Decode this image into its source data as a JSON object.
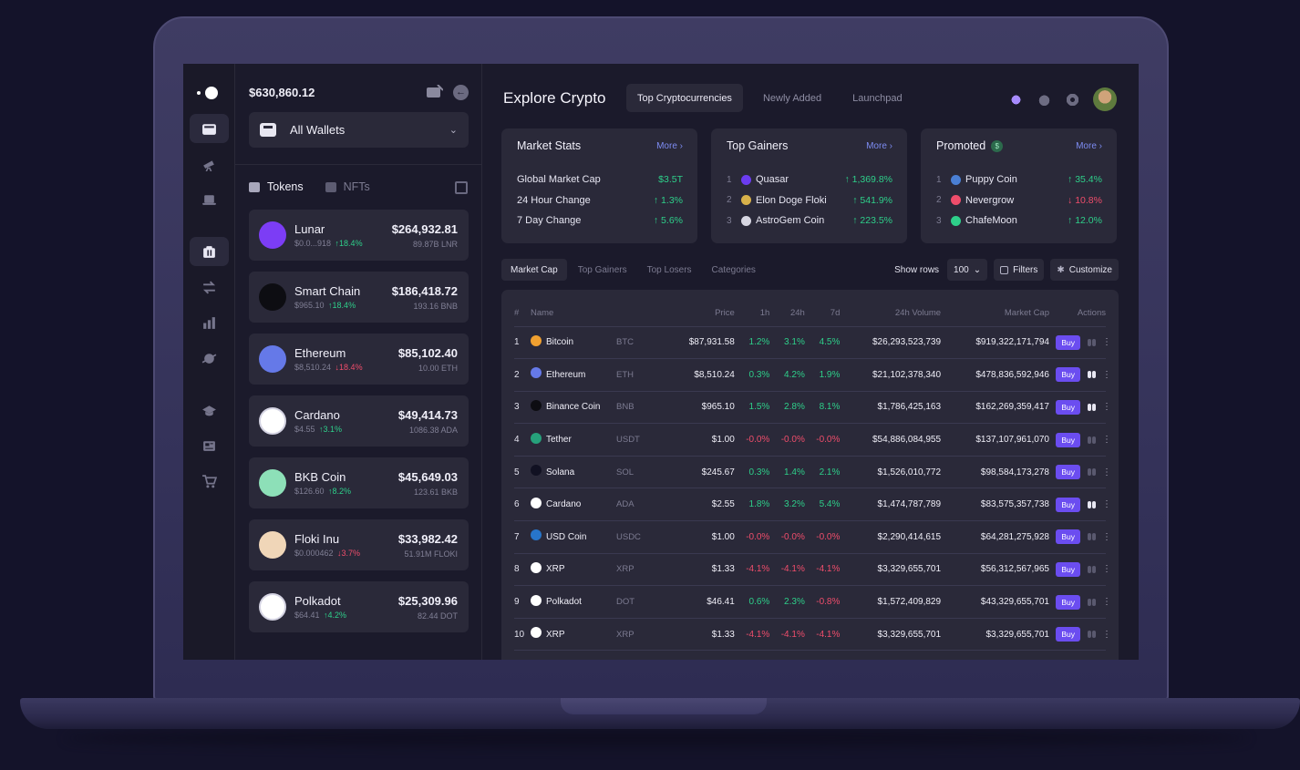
{
  "wallet": {
    "balance": "$630,860.12",
    "selector_label": "All Wallets",
    "tabs": {
      "tokens": "Tokens",
      "nfts": "NFTs"
    },
    "tokens": [
      {
        "name": "Lunar",
        "price": "$0.0...918",
        "change": "18.4%",
        "dir": "up",
        "value": "$264,932.81",
        "amount": "89.87B LNR",
        "color": "#7c3df5"
      },
      {
        "name": "Smart Chain",
        "price": "$965.10",
        "change": "18.4%",
        "dir": "up",
        "value": "$186,418.72",
        "amount": "193.16 BNB",
        "color": "#0d0d12"
      },
      {
        "name": "Ethereum",
        "price": "$8,510.24",
        "change": "18.4%",
        "dir": "down",
        "value": "$85,102.40",
        "amount": "10.00 ETH",
        "color": "#6579e8"
      },
      {
        "name": "Cardano",
        "price": "$4.55",
        "change": "3.1%",
        "dir": "up",
        "value": "$49,414.73",
        "amount": "1086.38 ADA",
        "color": "#ffffff"
      },
      {
        "name": "BKB Coin",
        "price": "$126.60",
        "change": "8.2%",
        "dir": "up",
        "value": "$45,649.03",
        "amount": "123.61 BKB",
        "color": "#8de0b8"
      },
      {
        "name": "Floki Inu",
        "price": "$0.000462",
        "change": "3.7%",
        "dir": "down",
        "value": "$33,982.42",
        "amount": "51.91M FLOKI",
        "color": "#f0d6b8"
      },
      {
        "name": "Polkadot",
        "price": "$64.41",
        "change": "4.2%",
        "dir": "up",
        "value": "$25,309.96",
        "amount": "82.44 DOT",
        "color": "#ffffff"
      }
    ]
  },
  "header": {
    "title": "Explore Crypto",
    "tabs": [
      "Top Cryptocurrencies",
      "Newly Added",
      "Launchpad"
    ]
  },
  "cards": {
    "market_stats": {
      "title": "Market Stats",
      "more": "More",
      "rows": [
        {
          "label": "Global Market Cap",
          "value": "$3.5T"
        },
        {
          "label": "24 Hour Change",
          "value": "1.3%"
        },
        {
          "label": "7 Day Change",
          "value": "5.6%"
        }
      ]
    },
    "top_gainers": {
      "title": "Top Gainers",
      "more": "More",
      "rows": [
        {
          "rank": "1",
          "name": "Quasar",
          "value": "1,369.8%",
          "color": "#6b3cf0"
        },
        {
          "rank": "2",
          "name": "Elon Doge Floki",
          "value": "541.9%",
          "color": "#d8b14a"
        },
        {
          "rank": "3",
          "name": "AstroGem Coin",
          "value": "223.5%",
          "color": "#d7d6e2"
        }
      ]
    },
    "promoted": {
      "title": "Promoted",
      "badge": "$",
      "more": "More",
      "rows": [
        {
          "rank": "1",
          "name": "Puppy Coin",
          "value": "35.4%",
          "dir": "up",
          "color": "#4a7fd4"
        },
        {
          "rank": "2",
          "name": "Nevergrow",
          "value": "10.8%",
          "dir": "down",
          "color": "#ef4d6b"
        },
        {
          "rank": "3",
          "name": "ChafeMoon",
          "value": "12.0%",
          "dir": "up",
          "color": "#2ecf8a"
        }
      ]
    }
  },
  "filters": {
    "tabs": [
      "Market Cap",
      "Top Gainers",
      "Top Losers",
      "Categories"
    ],
    "show_rows_label": "Show rows",
    "show_rows_value": "100",
    "filters_label": "Filters",
    "customize_label": "Customize"
  },
  "table": {
    "columns": [
      "#",
      "Name",
      "Price",
      "1h",
      "24h",
      "7d",
      "24h Volume",
      "Market Cap",
      "Actions"
    ],
    "buy_label": "Buy",
    "rows": [
      {
        "rank": "1",
        "name": "Bitcoin",
        "symbol": "BTC",
        "price": "$87,931.58",
        "h1": "1.2%",
        "h24": "3.1%",
        "d7": "4.5%",
        "volume": "$26,293,523,739",
        "mcap": "$919,322,171,794",
        "coin_color": "#f0a030",
        "watch": false,
        "tone": [
          "up",
          "up",
          "up"
        ]
      },
      {
        "rank": "2",
        "name": "Ethereum",
        "symbol": "ETH",
        "price": "$8,510.24",
        "h1": "0.3%",
        "h24": "4.2%",
        "d7": "1.9%",
        "volume": "$21,102,378,340",
        "mcap": "$478,836,592,946",
        "coin_color": "#6579e8",
        "watch": true,
        "tone": [
          "up",
          "up",
          "up"
        ]
      },
      {
        "rank": "3",
        "name": "Binance Coin",
        "symbol": "BNB",
        "price": "$965.10",
        "h1": "1.5%",
        "h24": "2.8%",
        "d7": "8.1%",
        "volume": "$1,786,425,163",
        "mcap": "$162,269,359,417",
        "coin_color": "#0d0d12",
        "watch": true,
        "tone": [
          "up",
          "up",
          "up"
        ]
      },
      {
        "rank": "4",
        "name": "Tether",
        "symbol": "USDT",
        "price": "$1.00",
        "h1": "-0.0%",
        "h24": "-0.0%",
        "d7": "-0.0%",
        "volume": "$54,886,084,955",
        "mcap": "$137,107,961,070",
        "coin_color": "#26a17b",
        "watch": false,
        "tone": [
          "dn",
          "dn",
          "dn"
        ]
      },
      {
        "rank": "5",
        "name": "Solana",
        "symbol": "SOL",
        "price": "$245.67",
        "h1": "0.3%",
        "h24": "1.4%",
        "d7": "2.1%",
        "volume": "$1,526,010,772",
        "mcap": "$98,584,173,278",
        "coin_color": "#111122",
        "watch": false,
        "tone": [
          "up",
          "up",
          "up"
        ]
      },
      {
        "rank": "6",
        "name": "Cardano",
        "symbol": "ADA",
        "price": "$2.55",
        "h1": "1.8%",
        "h24": "3.2%",
        "d7": "5.4%",
        "volume": "$1,474,787,789",
        "mcap": "$83,575,357,738",
        "coin_color": "#ffffff",
        "watch": true,
        "tone": [
          "up",
          "up",
          "up"
        ]
      },
      {
        "rank": "7",
        "name": "USD Coin",
        "symbol": "USDC",
        "price": "$1.00",
        "h1": "-0.0%",
        "h24": "-0.0%",
        "d7": "-0.0%",
        "volume": "$2,290,414,615",
        "mcap": "$64,281,275,928",
        "coin_color": "#2775ca",
        "watch": false,
        "tone": [
          "dn",
          "dn",
          "dn"
        ]
      },
      {
        "rank": "8",
        "name": "XRP",
        "symbol": "XRP",
        "price": "$1.33",
        "h1": "-4.1%",
        "h24": "-4.1%",
        "d7": "-4.1%",
        "volume": "$3,329,655,701",
        "mcap": "$56,312,567,965",
        "coin_color": "#ffffff",
        "watch": false,
        "tone": [
          "dn",
          "up",
          "up"
        ]
      },
      {
        "rank": "9",
        "name": "Polkadot",
        "symbol": "DOT",
        "price": "$46.41",
        "h1": "0.6%",
        "h24": "2.3%",
        "d7": "-0.8%",
        "volume": "$1,572,409,829",
        "mcap": "$43,329,655,701",
        "coin_color": "#ffffff",
        "watch": false,
        "tone": [
          "up",
          "up",
          "dn"
        ]
      },
      {
        "rank": "10",
        "name": "XRP",
        "symbol": "XRP",
        "price": "$1.33",
        "h1": "-4.1%",
        "h24": "-4.1%",
        "d7": "-4.1%",
        "volume": "$3,329,655,701",
        "mcap": "$3,329,655,701",
        "coin_color": "#ffffff",
        "watch": false,
        "tone": [
          "up",
          "up",
          "up"
        ]
      }
    ]
  }
}
